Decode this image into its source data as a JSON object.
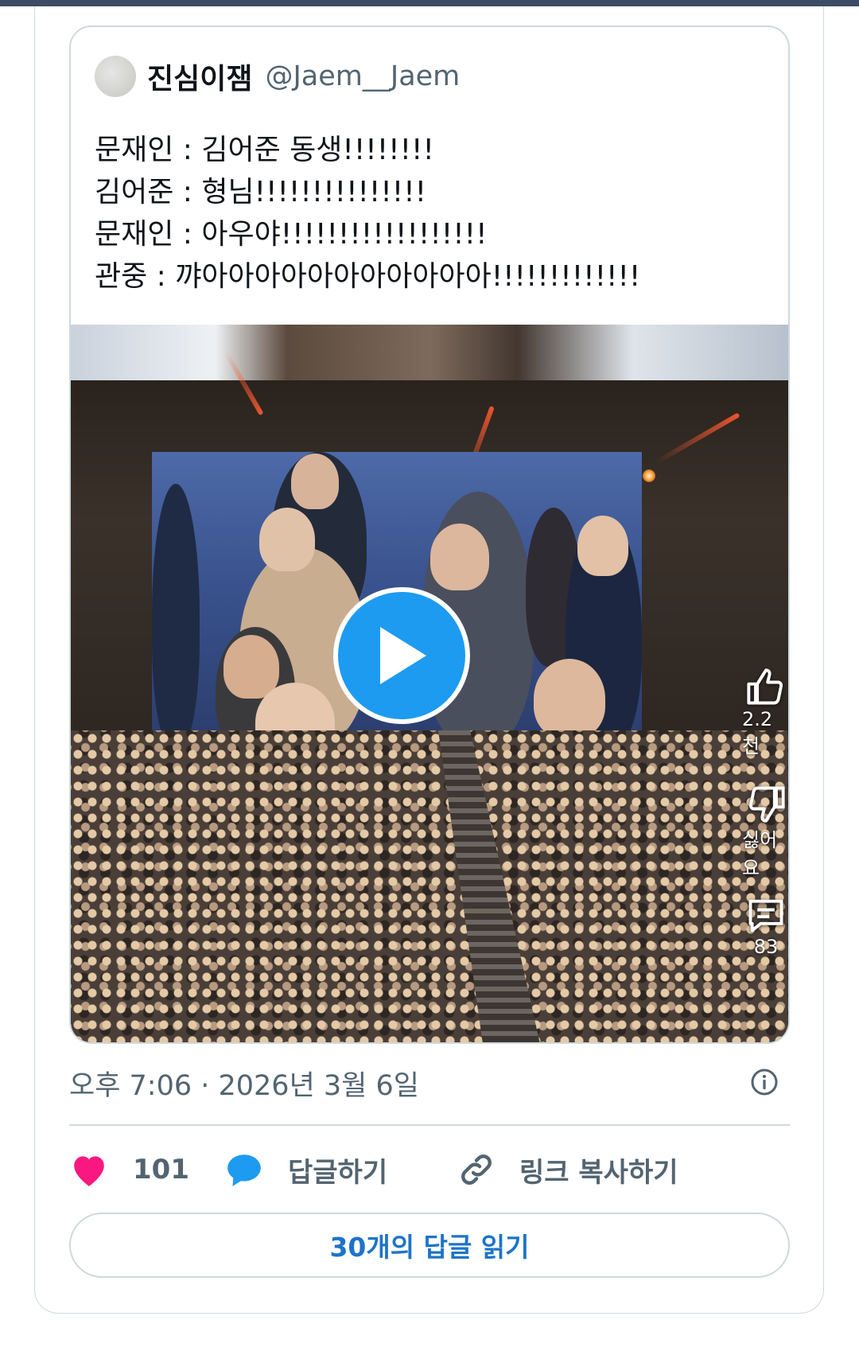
{
  "quoted_tweet": {
    "display_name": "진심이잼",
    "handle": "@Jaem__Jaem",
    "text_lines": [
      "문재인 : 김어준 동생!!!!!!!!",
      "김어준 : 형님!!!!!!!!!!!!!!!",
      "문재인 : 아우야!!!!!!!!!!!!!!!!!!",
      "관중 : 꺄아아아아아아아아아아아!!!!!!!!!!!!!"
    ],
    "video": {
      "like_count": "2.2천",
      "dislike_label": "싫어요",
      "comment_count": "83"
    }
  },
  "timestamp": "오후 7:06 · 2026년 3월 6일",
  "actions": {
    "like_count": "101",
    "reply_label": "답글하기",
    "copy_link_label": "링크 복사하기"
  },
  "read_replies_label": "30개의 답글 읽기",
  "colors": {
    "like": "#f91880",
    "reply": "#1d9bf0",
    "play_button": "#1d9bf0",
    "read_replies_text": "#1d74c9"
  },
  "icons": {
    "play": "play-icon",
    "info": "info-icon",
    "like": "heart-icon",
    "reply": "speech-bubble-icon",
    "copy_link": "link-icon",
    "video_like": "thumbs-up-icon",
    "video_dislike": "thumbs-down-icon",
    "video_comment": "comment-icon"
  }
}
